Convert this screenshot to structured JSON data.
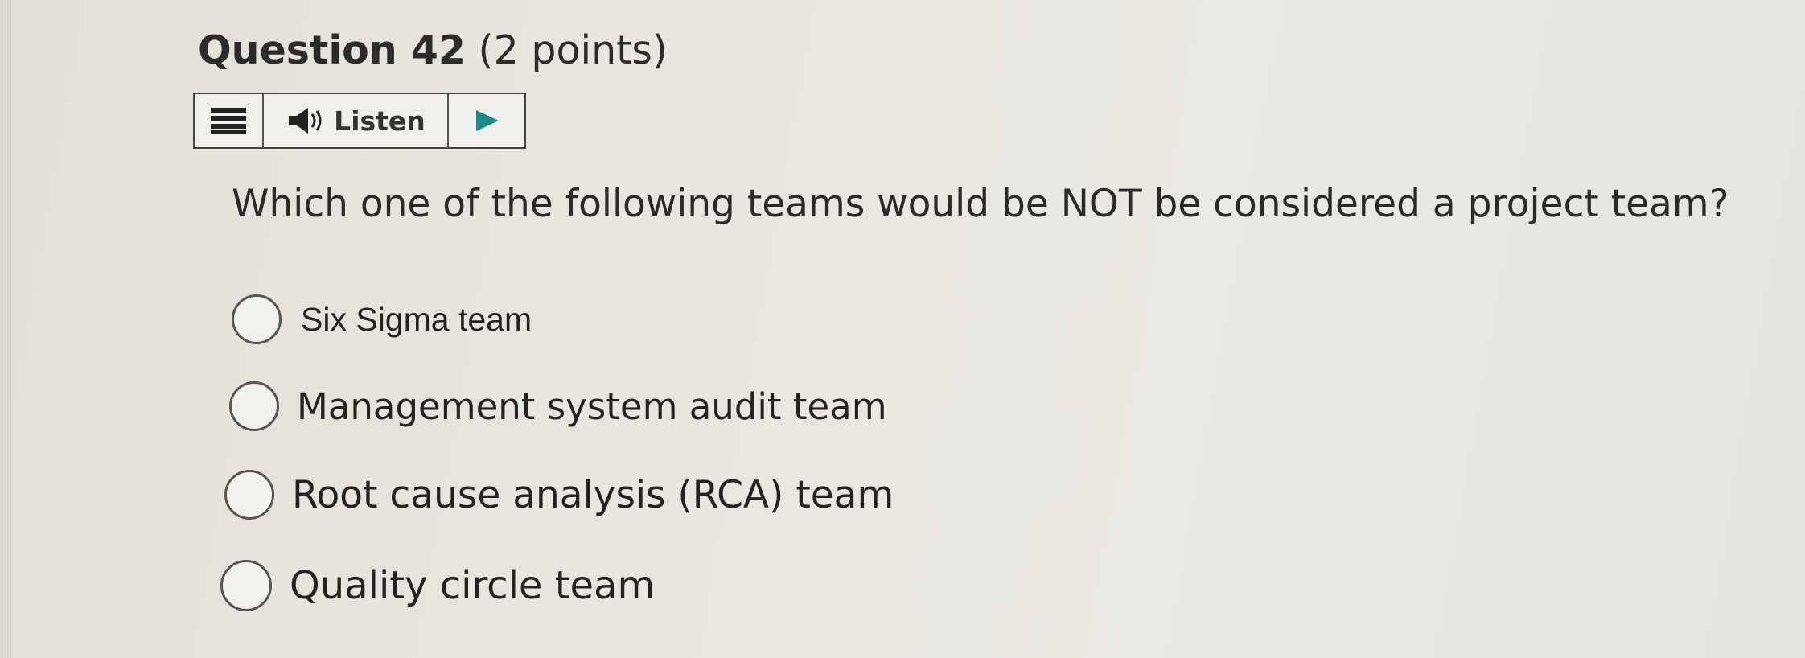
{
  "question": {
    "number_label": "Question 42",
    "points_label": "(2 points)",
    "text": "Which one of the following teams would be NOT be considered a project team?"
  },
  "toolbar": {
    "listen_label": "Listen",
    "icons": [
      "menu-icon",
      "speaker-icon",
      "play-icon"
    ]
  },
  "options": [
    {
      "label": "Six Sigma team",
      "selected": false
    },
    {
      "label": "Management system audit team",
      "selected": false
    },
    {
      "label": "Root cause analysis (RCA) team",
      "selected": false
    },
    {
      "label": "Quality circle team",
      "selected": false
    }
  ]
}
